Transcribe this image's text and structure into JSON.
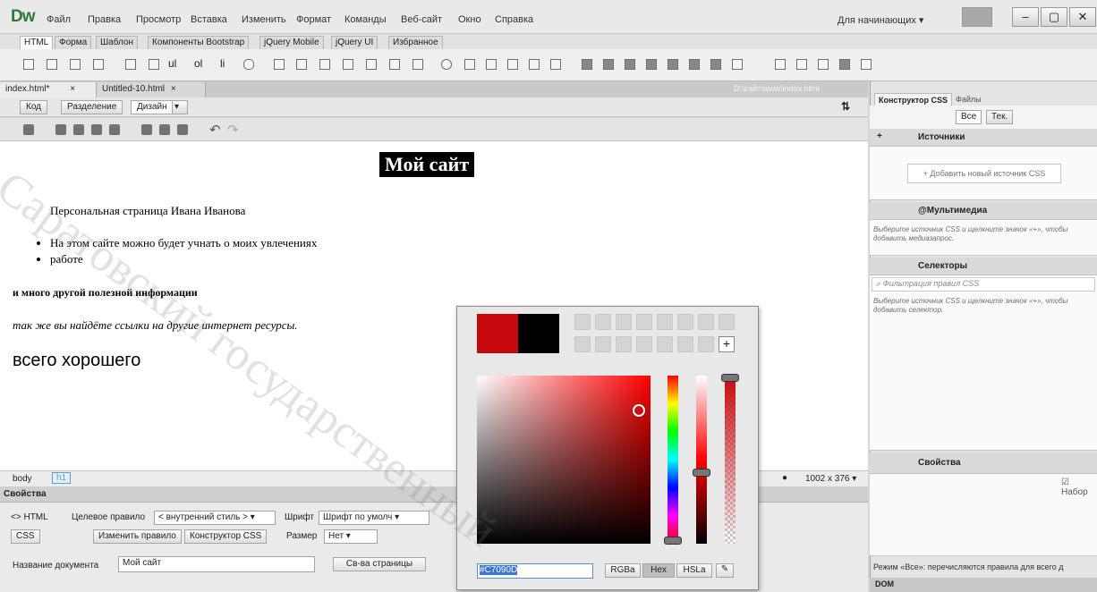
{
  "app": {
    "logo": "Dw",
    "menu": [
      "Файл",
      "Правка",
      "Просмотр",
      "Вставка",
      "Изменить",
      "Формат",
      "Команды",
      "Веб-сайт",
      "Окно",
      "Справка"
    ],
    "workspace": "Для начинающих",
    "window_controls": [
      "–",
      "▢",
      "✕"
    ]
  },
  "insert_tabs": [
    "HTML",
    "Форма",
    "Шаблон",
    "Компоненты Bootstrap",
    "jQuery Mobile",
    "jQuery UI",
    "Избранное"
  ],
  "insert_bar_text": [
    "ul",
    "ol",
    "li"
  ],
  "document_tabs": [
    {
      "label": "index.html*",
      "close": "×"
    },
    {
      "label": "Untitled-10.html",
      "close": "×"
    }
  ],
  "document_path": "D:\\сайт\\www\\index.html",
  "view_buttons": [
    "Код",
    "Разделение",
    "Дизайн"
  ],
  "design": {
    "heading": "Мой сайт",
    "intro": "Персональная страница Ивана Иванова",
    "list": [
      "На этом сайте можно будет учнать о моих увлечениях",
      "работе"
    ],
    "bold": "и много другой полезной информации",
    "italic": "так же вы найдёте ссылки на другие интернет ресурсы.",
    "big": "всего хорошего"
  },
  "statusbar": {
    "tags": [
      "body",
      "h1"
    ],
    "size": "1002 x 376"
  },
  "properties": {
    "title": "Свойства",
    "html_button": "HTML",
    "css_button": "CSS",
    "target_rule_label": "Целевое правило",
    "target_rule_value": "< внутренний стиль >",
    "edit_rule": "Изменить правило",
    "css_designer": "Конструктор CSS",
    "font_label": "Шрифт",
    "font_value": "Шрифт по умолч",
    "size_label": "Размер",
    "size_value": "Нет",
    "doc_title_label": "Название документа",
    "doc_title_value": "Мой сайт",
    "page_props": "Св-ва страницы"
  },
  "css_panel": {
    "tabs": [
      "Конструктор CSS",
      "Файлы"
    ],
    "toggle": [
      "Все",
      "Тек."
    ],
    "sources_header": "Источники",
    "add_source": "+ Добавить новый источник CSS",
    "media_header": "@Мультимедиа",
    "media_hint": "Выберите источник CSS и щелкните значок «+», чтобы добавить медиазапрос.",
    "selectors_header": "Селекторы",
    "filter_placeholder": "Фильтрация правил CSS",
    "selectors_hint": "Выберите источник CSS и щелкните значок «+», чтобы добавить селектор.",
    "properties_header": "Свойства",
    "show_set": "Набор",
    "footer_note": "Режим «Все»: перечисляются правила для всего д",
    "dom_tab": "DOM"
  },
  "color_picker": {
    "hex_value": "#C7090D",
    "modes": [
      "RGBa",
      "Hex",
      "HSLa"
    ],
    "current_color": "#c7090d",
    "previous_color": "#000000",
    "add_swatch": "+"
  },
  "watermark": "Саратовский государственный"
}
